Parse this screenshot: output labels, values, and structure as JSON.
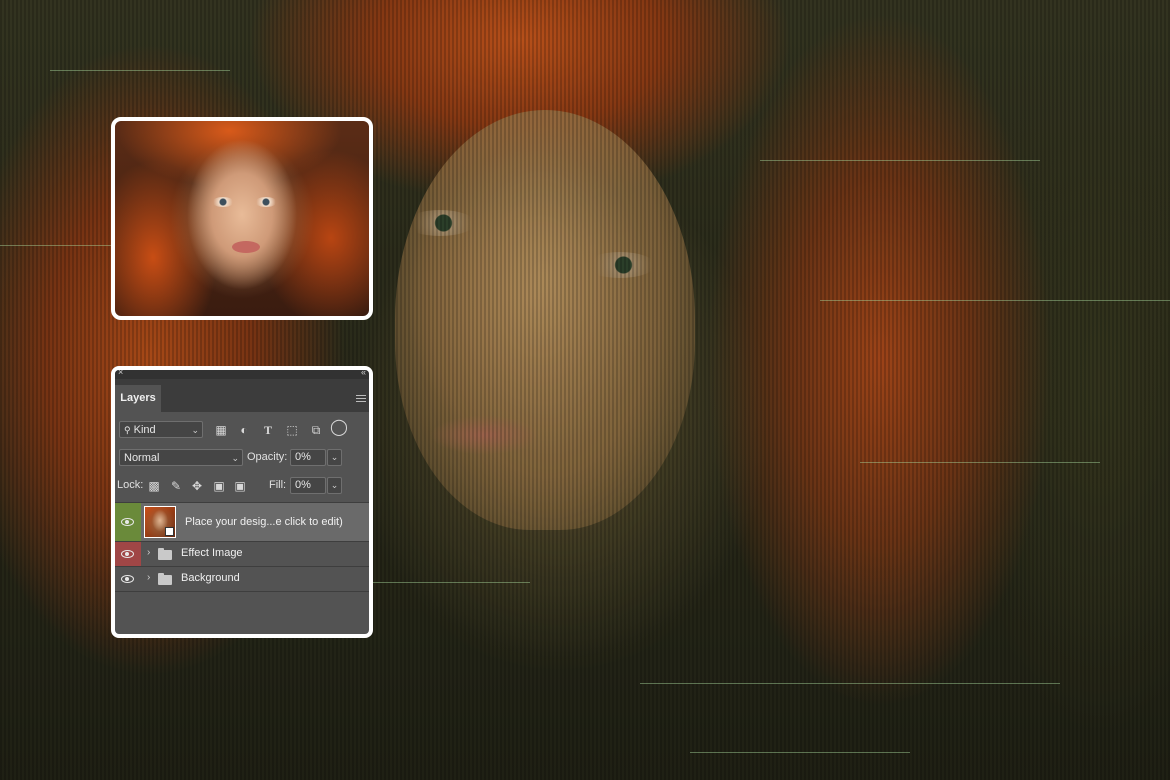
{
  "panel": {
    "close_icon": "×",
    "collapse_icon": "«",
    "tab_label": "Layers",
    "filter": {
      "kind_label": "Kind",
      "icons": [
        "image-filter-icon",
        "adjustment-filter-icon",
        "type-filter-icon",
        "shape-filter-icon",
        "smart-object-filter-icon",
        "filter-toggle-icon"
      ]
    },
    "blend_mode": "Normal",
    "opacity_label": "Opacity:",
    "opacity_value": "0%",
    "lock_label": "Lock:",
    "fill_label": "Fill:",
    "fill_value": "0%",
    "layers": [
      {
        "name": "Place your desig...e click to edit)",
        "type": "smart-object",
        "visible": true,
        "selected": true,
        "eye_color": "#6a8a3a"
      },
      {
        "name": "Effect Image",
        "type": "group",
        "visible": true,
        "selected": false,
        "eye_color": "#a04646"
      },
      {
        "name": "Background",
        "type": "group",
        "visible": true,
        "selected": false,
        "eye_color": ""
      }
    ]
  },
  "colors": {
    "panel_bg": "#535353",
    "tab_bar": "#3c3c3c",
    "selected_row": "#6a6a6a",
    "card_border": "#ffffff"
  }
}
